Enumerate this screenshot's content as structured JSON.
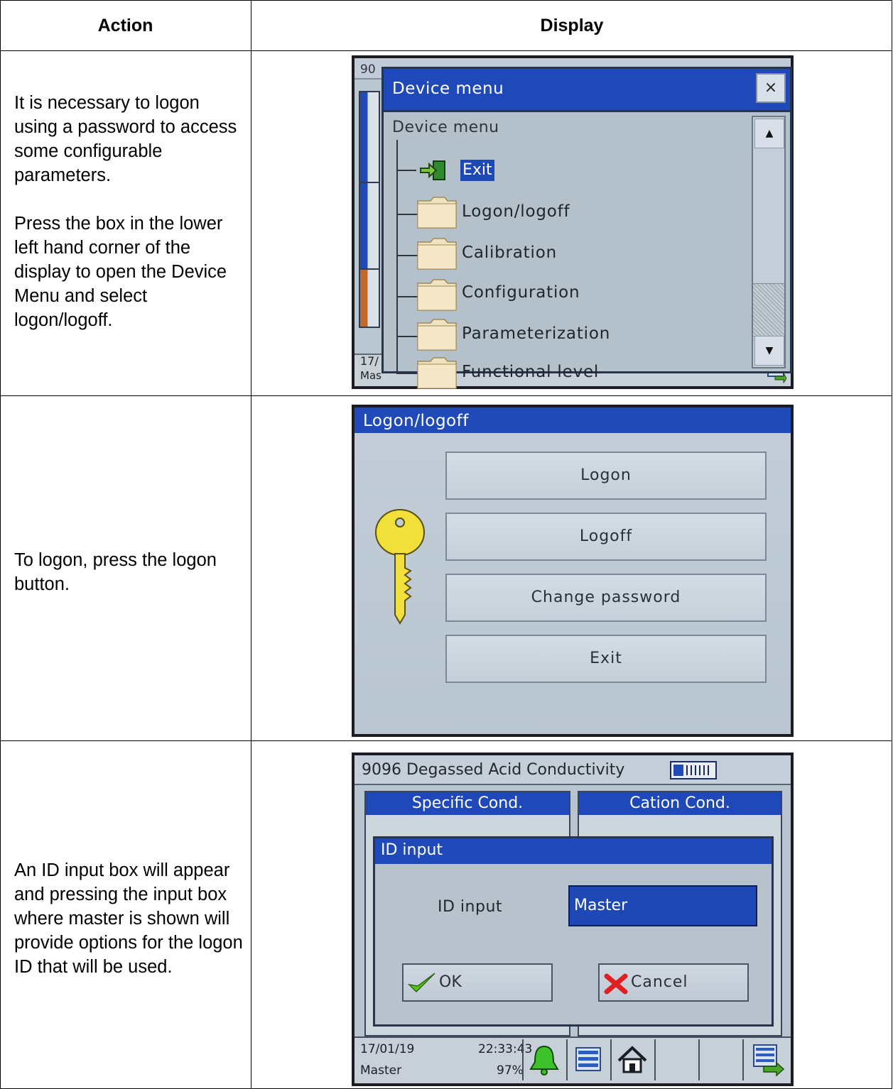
{
  "table": {
    "headers": {
      "action": "Action",
      "display": "Display"
    },
    "rows": [
      {
        "action": [
          "It is necessary to logon using a password to access some configurable parameters.",
          "Press the box in the lower left hand corner of the display to open the Device Menu and select logon/logoff."
        ]
      },
      {
        "action": [
          "To logon, press the logon button."
        ]
      },
      {
        "action": [
          "An ID input box will appear and pressing the input box where master is shown will provide options for the logon ID that will be used."
        ]
      }
    ]
  },
  "screen1": {
    "behind": {
      "top_left": "90",
      "date": "17/",
      "user": "Mas"
    },
    "dialog_title": "Device menu",
    "close_glyph": "×",
    "tree_root": "Device menu",
    "items": [
      "Exit",
      "Logon/logoff",
      "Calibration",
      "Configuration",
      "Parameterization",
      "Functional level"
    ],
    "scroll_up": "▲",
    "scroll_down": "▼",
    "tile_colors": [
      "#1f4ab8",
      "#1f4ab8",
      "#c2682a",
      "#1f4ab8",
      "#1f4ab8",
      "#6f86b5"
    ]
  },
  "screen2": {
    "title": "Logon/logoff",
    "buttons": [
      "Logon",
      "Logoff",
      "Change password",
      "Exit"
    ],
    "key_color": "#f2e03a"
  },
  "screen3": {
    "app_title": "9096 Degassed Acid Conductivity",
    "panels": [
      "Specific Cond.",
      "Cation Cond."
    ],
    "dialog_title": "ID input",
    "id_label": "ID input",
    "id_value": "Master",
    "ok_label": "OK",
    "cancel_label": "Cancel",
    "status": {
      "date": "17/01/19",
      "time": "22:33:43",
      "user": "Master",
      "percent": "97%"
    }
  }
}
